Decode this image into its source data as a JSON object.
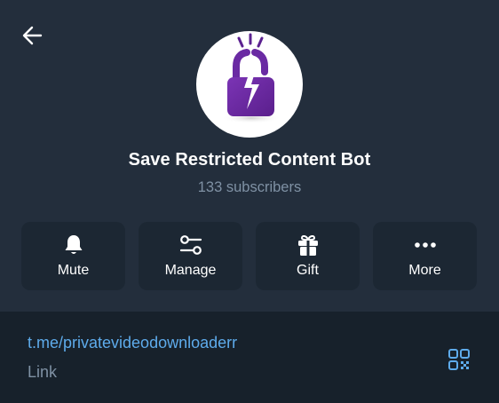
{
  "channel": {
    "title": "Save Restricted Content Bot",
    "subscribers": "133 subscribers",
    "avatar_icon": "padlock-lightning-logo"
  },
  "navigation": {
    "back_icon": "back-arrow-icon"
  },
  "actions": [
    {
      "label": "Mute",
      "icon": "bell-icon"
    },
    {
      "label": "Manage",
      "icon": "sliders-icon"
    },
    {
      "label": "Gift",
      "icon": "gift-icon"
    },
    {
      "label": "More",
      "icon": "more-dots-icon"
    }
  ],
  "info": {
    "link": "t.me/privatevideodownloaderr",
    "link_caption": "Link",
    "qr_icon": "qr-code-icon"
  },
  "colors": {
    "header_bg": "#232e3c",
    "page_bg": "#17212b",
    "button_bg": "#1c2733",
    "link": "#5eabeb",
    "secondary_text": "#7f91a4",
    "logo_purple": "#6a2aa3"
  }
}
